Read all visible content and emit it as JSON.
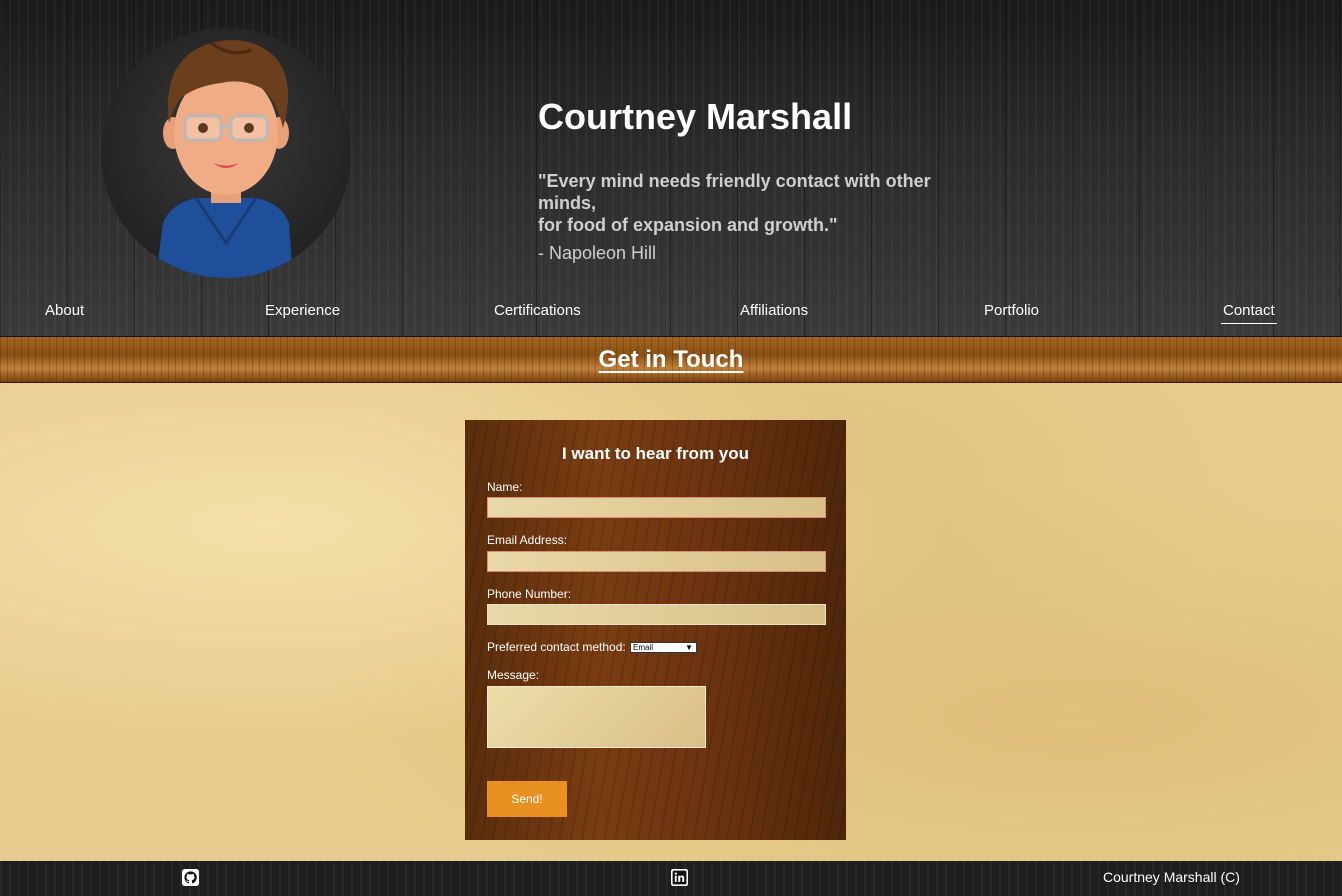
{
  "header": {
    "name": "Courtney Marshall",
    "quote_line1": "\"Every mind needs friendly contact with other minds,",
    "quote_line2": "for food of expansion and growth.\"",
    "author": "- Napoleon Hill"
  },
  "nav": {
    "items": [
      "About",
      "Experience",
      "Certifications",
      "Affiliations",
      "Portfolio",
      "Contact"
    ],
    "active": "Contact"
  },
  "banner": {
    "title": "Get in Touch"
  },
  "form": {
    "title": "I want to hear from you",
    "name_label": "Name:",
    "name_value": "",
    "email_label": "Email Address:",
    "email_value": "",
    "phone_label": "Phone Number:",
    "phone_value": "",
    "method_label": "Preferred contact method:",
    "method_value": "Email",
    "message_label": "Message:",
    "message_value": "",
    "send_label": "Send!"
  },
  "footer": {
    "icons": [
      "github-icon",
      "linkedin-icon"
    ],
    "copyright": "Courtney Marshall (C)"
  },
  "colors": {
    "accent": "#e89121",
    "header_bg": "#2b2b2b",
    "card_bg": "#6b3310",
    "invalid_border": "#e08a7a"
  }
}
